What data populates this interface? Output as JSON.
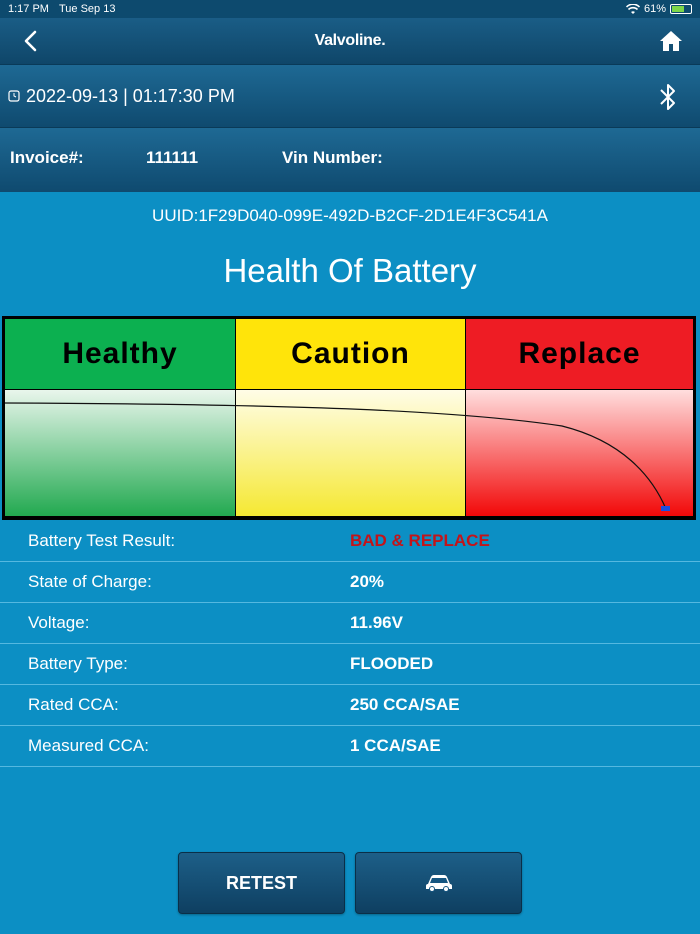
{
  "status_bar": {
    "time": "1:17 PM",
    "date": "Tue Sep 13",
    "battery": "61%"
  },
  "nav": {
    "brand": "Valvoline."
  },
  "header": {
    "datetime": "2022-09-13 | 01:17:30 PM"
  },
  "invoice": {
    "invoice_label": "Invoice#:",
    "invoice_value": "111111",
    "vin_label": "Vin Number:",
    "vin_value": ""
  },
  "uuid": "UUID:1F29D040-099E-492D-B2CF-2D1E4F3C541A",
  "title": "Health Of Battery",
  "zones": {
    "healthy": "Healthy",
    "caution": "Caution",
    "replace": "Replace"
  },
  "colors": {
    "healthy": "#0cb050",
    "caution": "#ffe40a",
    "replace": "#ee1c24",
    "bad_text": "#c3141a",
    "background": "#0c8fc4"
  },
  "results": [
    {
      "label": "Battery Test Result:",
      "value": "BAD & REPLACE",
      "status": "bad"
    },
    {
      "label": "State of Charge:",
      "value": "20%"
    },
    {
      "label": "Voltage:",
      "value": "11.96V"
    },
    {
      "label": "Battery Type:",
      "value": "FLOODED"
    },
    {
      "label": "Rated CCA:",
      "value": "250 CCA/SAE"
    },
    {
      "label": "Measured CCA:",
      "value": "1 CCA/SAE"
    }
  ],
  "buttons": {
    "retest": "RETEST",
    "vehicle_icon": "car-icon"
  },
  "icons": [
    "back-icon",
    "home-icon",
    "clock-icon",
    "bluetooth-icon",
    "car-icon",
    "wifi-icon"
  ]
}
